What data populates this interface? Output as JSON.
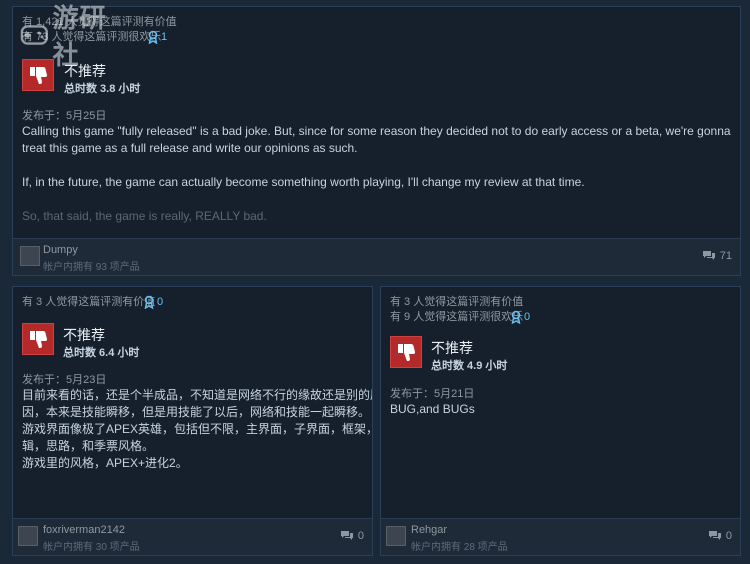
{
  "watermark": {
    "text": "游研社"
  },
  "review1": {
    "helpful": "有 1,421 人觉得这篇评测有价值",
    "funny": "有 73 人觉得这篇评测很欢乐",
    "awards": "1",
    "verdict": "不推荐",
    "hours": "总时数 3.8 小时",
    "posted": "发布于：5月25日",
    "paragraphs": [
      "Calling this game \"fully released\" is a bad joke. But, since for some reason they decided not to do early access or a beta, we're gonna treat this game as a full release and write our opinions as such.",
      "If, in the future, the game can actually become something worth playing, I'll change my review at that time.",
      "So, that said, the game is really, REALLY bad."
    ],
    "user": "Dumpy",
    "owned": "帐户内拥有 93 项产品",
    "comments": "71"
  },
  "review2": {
    "helpful": "有 3 人觉得这篇评测有价值",
    "awards": "0",
    "verdict": "不推荐",
    "hours": "总时数 6.4 小时",
    "posted": "发布于：5月23日",
    "lines": [
      "目前来看的话，还是个半成品，不知道是网络不行的缘故还是别的原",
      "因，本来是技能瞬移，但是用技能了以后，网络和技能一起瞬移。",
      "游戏界面像极了APEX英雄，包括但不限，主界面，子界面，框架，逻",
      "辑，思路，和季票风格。",
      "游戏里的风格，APEX+进化2。"
    ],
    "user": "foxriverman2142",
    "owned": "帐户内拥有 30 项产品",
    "comments": "0"
  },
  "review3": {
    "helpful": "有 3 人觉得这篇评测有价值",
    "funny": "有 9 人觉得这篇评测很欢乐",
    "awards": "0",
    "verdict": "不推荐",
    "hours": "总时数 4.9 小时",
    "posted": "发布于：5月21日",
    "text": "BUG,and BUGs",
    "user": "Rehgar",
    "owned": "帐户内拥有 28 项产品",
    "comments": "0"
  }
}
